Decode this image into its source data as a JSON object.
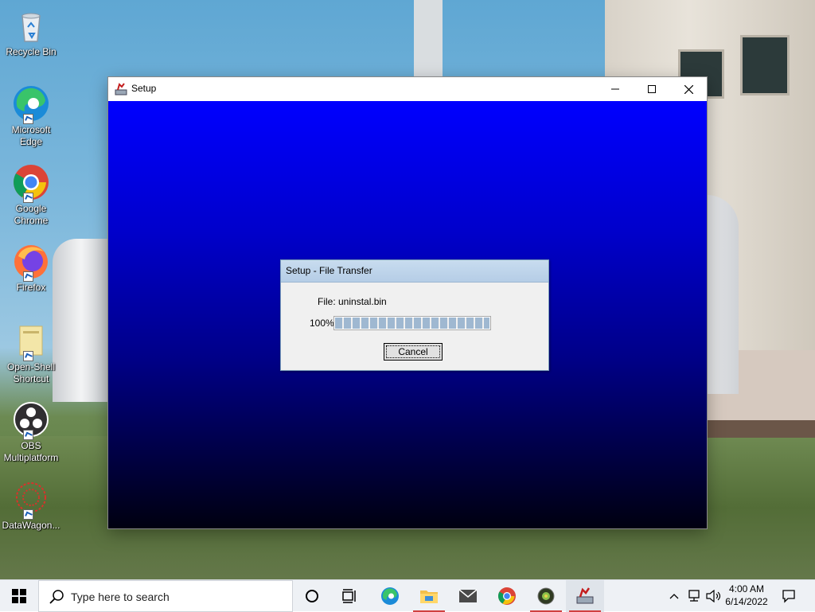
{
  "desktop": {
    "icons": [
      {
        "label": "Recycle Bin"
      },
      {
        "label": "Microsoft Edge"
      },
      {
        "label": "Google Chrome"
      },
      {
        "label": "Firefox"
      },
      {
        "label": "Open-Shell Shortcut"
      },
      {
        "label": "OBS Multiplatform"
      },
      {
        "label": "DataWagon..."
      }
    ]
  },
  "setup_window": {
    "title": "Setup",
    "controls": {
      "minimize": "minimize",
      "maximize": "maximize",
      "close": "close"
    }
  },
  "transfer_dialog": {
    "title": "Setup - File Transfer",
    "file_label": "File: uninstal.bin",
    "percent_label": "100%",
    "progress_fraction": 1.0,
    "cancel_label": "Cancel"
  },
  "taskbar": {
    "search_placeholder": "Type here to search",
    "time": "4:00 AM",
    "date": "6/14/2022",
    "apps": [
      "task-view",
      "edge",
      "file-explorer",
      "mail",
      "chrome",
      "app-globe",
      "setup"
    ]
  },
  "colors": {
    "setup_gradient_top": "#0000ff",
    "setup_gradient_bottom": "#000010",
    "progress_fill": "#9fb8d1",
    "running_indicator": "#d04040"
  }
}
